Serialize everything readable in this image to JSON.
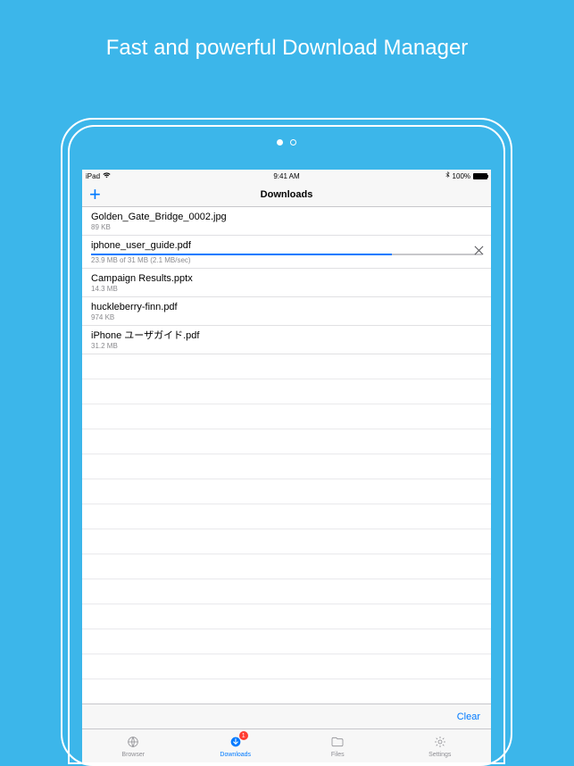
{
  "promo": {
    "title": "Fast and powerful Download Manager"
  },
  "status": {
    "carrier": "iPad",
    "time": "9:41 AM",
    "battery_pct": "100%"
  },
  "nav": {
    "title": "Downloads",
    "add_label": "+"
  },
  "downloads": [
    {
      "filename": "Golden_Gate_Bridge_0002.jpg",
      "meta": "89 KB",
      "in_progress": false
    },
    {
      "filename": "iphone_user_guide.pdf",
      "meta": "23.9 MB of 31 MB (2.1 MB/sec)",
      "in_progress": true,
      "progress_pct": 77
    },
    {
      "filename": "Campaign Results.pptx",
      "meta": "14.3 MB",
      "in_progress": false
    },
    {
      "filename": "huckleberry-finn.pdf",
      "meta": "974 KB",
      "in_progress": false
    },
    {
      "filename": "iPhone ユーザガイド.pdf",
      "meta": "31.2 MB",
      "in_progress": false
    }
  ],
  "toolbar": {
    "clear_label": "Clear"
  },
  "tabs": {
    "browser": "Browser",
    "downloads": "Downloads",
    "files": "Files",
    "settings": "Settings",
    "badge": "1"
  }
}
